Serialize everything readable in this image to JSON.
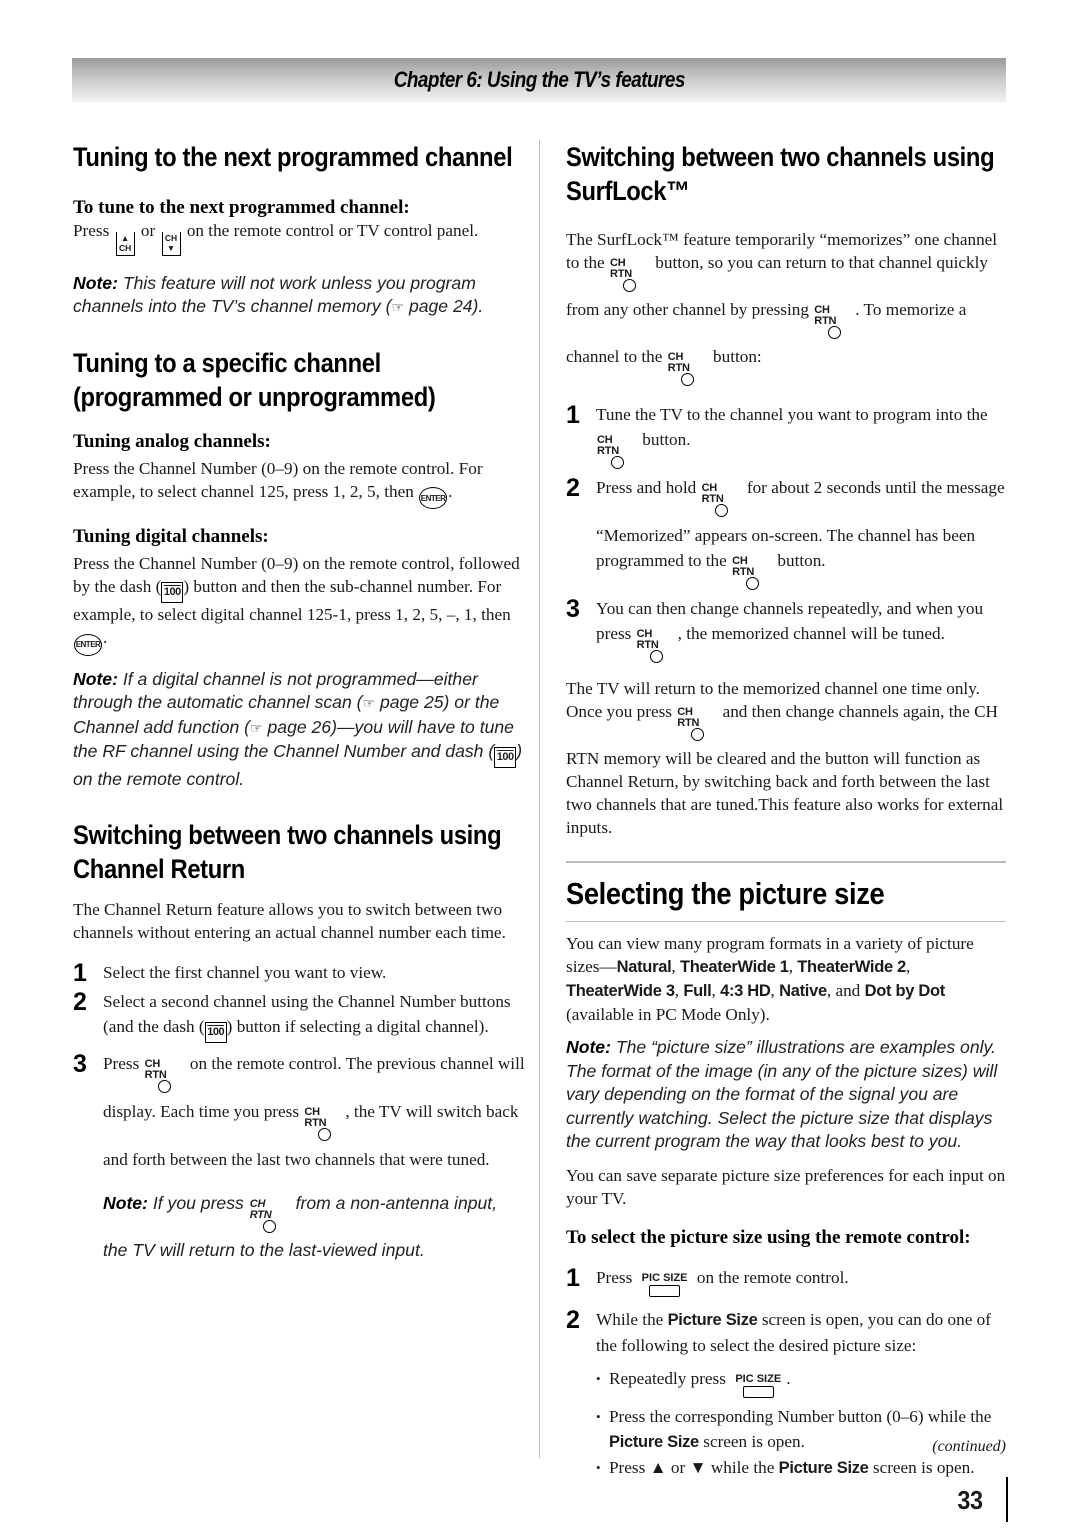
{
  "header": {
    "chapter_title": "Chapter 6: Using the TV’s features"
  },
  "buttons": {
    "ch": "CH",
    "ch_rtn": "CH RTN",
    "pic_size": "PIC SIZE",
    "enter": "ENTER",
    "dash": "100"
  },
  "left": {
    "s1": {
      "title": "Tuning to the next programmed channel",
      "subheading": "To tune to the next programmed channel:",
      "body": [
        "Press",
        "or",
        "on the remote control or TV control panel."
      ],
      "note_label": "Note:",
      "note_text": "This feature will not work unless you program channels into the TV’s channel memory (",
      "note_ref": "page 24)."
    },
    "s2": {
      "title": "Tuning to a specific channel (programmed or unprogrammed)",
      "analog_heading": "Tuning analog channels:",
      "analog_body": "Press the Channel Number (0–9) on the remote control. For example, to select channel 125, press 1, 2, 5, then",
      "digital_heading": "Tuning digital channels:",
      "digital_body_1": "Press the Channel Number (0–9) on the remote control, followed by the dash (",
      "digital_body_2": ") button and then the sub-channel number. For example, to select digital channel 125-1, press 1, 2, 5, –, 1, then",
      "note_label": "Note:",
      "note_1": "If a digital channel is not programmed—either through the automatic channel scan (",
      "note_2": "page 25) or the Channel add function (",
      "note_3": "page 26)—you will have to tune the RF channel using the Channel Number and dash (",
      "note_4": ") on the remote control."
    },
    "s3": {
      "title": "Switching between two channels using Channel Return",
      "intro": "The Channel Return feature allows you to switch between two channels without entering an actual channel number each time.",
      "steps": [
        {
          "num": "1",
          "text": "Select the first channel you want to view."
        },
        {
          "num": "2",
          "text_a": "Select a second channel using the Channel Number buttons (and the dash (",
          "text_b": ") button if selecting a digital channel)."
        },
        {
          "num": "3",
          "text_a": "Press",
          "text_b": "on the remote control. The previous channel will display. Each time you press",
          "text_c": ", the TV will switch back and forth between the last two channels that were tuned."
        }
      ],
      "note_label": "Note:",
      "note_a": "If you press",
      "note_b": "from a non-antenna input, the TV will return to the last-viewed input."
    }
  },
  "right": {
    "s4": {
      "title": "Switching between two channels using SurfLock™",
      "intro_a": "The SurfLock™ feature temporarily “memorizes” one channel to the",
      "intro_b": "button, so you can return to that channel quickly from any other channel by pressing",
      "intro_c": ". To memorize a channel to the",
      "intro_d": "button:",
      "steps": [
        {
          "num": "1",
          "text_a": "Tune the TV to the channel you want to program into the",
          "text_b": "button."
        },
        {
          "num": "2",
          "text_a": "Press and hold",
          "text_b": "for about 2 seconds until the message “Memorized” appears on-screen. The channel has been programmed to the",
          "text_c": "button."
        },
        {
          "num": "3",
          "text_a": "You can then change channels repeatedly, and when you press",
          "text_b": ", the memorized channel will be tuned."
        }
      ],
      "outro_a": "The TV will return to the memorized channel one time only. Once you press",
      "outro_b": "and then change channels again, the CH RTN memory will be cleared and the button will function as Channel Return, by switching back and forth between the last two channels that are tuned.This feature also works for external inputs."
    },
    "s5": {
      "title": "Selecting the picture size",
      "intro_a": "You can view many program formats in a variety of picture sizes—",
      "sizes": [
        "Natural",
        "TheaterWide 1",
        "TheaterWide 2",
        "TheaterWide 3",
        "Full",
        "4:3 HD",
        "Native",
        "Dot by Dot"
      ],
      "intro_and": "and",
      "intro_b": "(available in PC Mode Only).",
      "note_label": "Note:",
      "note_text": "The “picture size” illustrations are examples only. The format of the image (in any of the picture sizes) will vary depending on the format of the signal you are currently watching. Select the picture size that displays the current program the way that looks best to you.",
      "save_text": "You can save separate picture size preferences for each input on your TV.",
      "remote_heading": "To select the picture size using the remote control:",
      "steps": [
        {
          "num": "1",
          "text_a": "Press",
          "text_b": "on the remote control."
        },
        {
          "num": "2",
          "text_a": "While the",
          "bold": "Picture Size",
          "text_b": "screen is open, you can do one of the following to select the desired picture size:"
        }
      ],
      "bullets": [
        {
          "text_a": "Repeatedly press",
          "text_b": "."
        },
        {
          "text_a": "Press the corresponding Number button (0–6) while the",
          "bold": "Picture Size",
          "text_b": "screen is open."
        },
        {
          "text_a": "Press",
          "up": "▲",
          "or": "or",
          "down": "▼",
          "text_b": "while the",
          "bold": "Picture Size",
          "text_c": "screen is open."
        }
      ]
    }
  },
  "footer": {
    "continued": "(continued)",
    "page_number": "33"
  }
}
